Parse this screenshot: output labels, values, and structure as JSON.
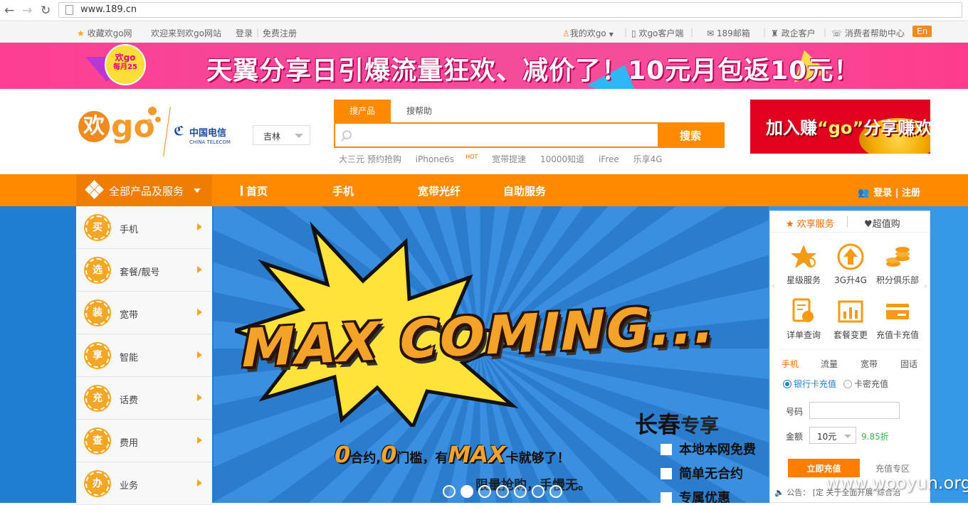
{
  "browser": {
    "url": "www.189.cn"
  },
  "topbar": {
    "favorite": "收藏欢go网",
    "welcome": "欢迎来到欢go网站",
    "login": "登录",
    "sep": "|",
    "register": "免费注册",
    "my_huango": "我的欢go",
    "client": "欢go客户端",
    "mail": "189邮箱",
    "gov": "政企客户",
    "help": "消费者帮助中心",
    "lang": "En"
  },
  "promo": {
    "badge_line1": "欢go",
    "badge_line2": "每月25",
    "title": "天翼分享日引爆流量狂欢、减价了！10元月包返10元！"
  },
  "header": {
    "logo_huan": "欢",
    "logo_go": "go",
    "telecom_cn": "中国电信",
    "telecom_en": "CHINA TELECOM",
    "city": "吉林",
    "ad_text_pre": "加入赚",
    "ad_text_go": "“go”",
    "ad_text_post": "分享赚欢豆"
  },
  "search": {
    "tab_products": "搜产品",
    "tab_help": "搜帮助",
    "placeholder": "",
    "button": "搜索",
    "hotwords": [
      "大三元 预约抢购",
      "iPhone6s",
      "宽带提速",
      "10000知道",
      "iFree",
      "乐享4G"
    ],
    "hot_tag": "HOT"
  },
  "nav": {
    "all_products": "全部产品及服务",
    "links": [
      "首页",
      "手机",
      "宽带光纤",
      "自助服务"
    ],
    "login": "登录",
    "register": "注册"
  },
  "sidemenu": [
    {
      "icon": "买",
      "label": "手机"
    },
    {
      "icon": "选",
      "label": "套餐/靓号"
    },
    {
      "icon": "装",
      "label": "宽带"
    },
    {
      "icon": "享",
      "label": "智能"
    },
    {
      "icon": "充",
      "label": "话费"
    },
    {
      "icon": "查",
      "label": "费用"
    },
    {
      "icon": "办",
      "label": "业务"
    }
  ],
  "banner": {
    "headline": "MAX COMING...",
    "city": "长春",
    "city_suffix": "专享",
    "slogan_zero1": "0",
    "slogan_a": "合约,",
    "slogan_zero2": "0",
    "slogan_b": "门槛，有",
    "slogan_max": "MAX",
    "slogan_c": "卡就够了！",
    "slogan2": "限量抢购，手慢无。",
    "features": [
      "本地本网免费",
      "简单无合约",
      "专属优惠"
    ],
    "slides": 7,
    "active_slide": 2
  },
  "panel": {
    "tab1": "欢享服务",
    "tab2": "超值购",
    "services": [
      "星级服务",
      "3G升4G",
      "积分俱乐部",
      "详单查询",
      "套餐变更",
      "充值卡充值"
    ],
    "recharge_tabs": [
      "手机",
      "流量",
      "宽带",
      "固话"
    ],
    "radio_bank": "银行卡充值",
    "radio_card": "卡密充值",
    "phone_label": "号码",
    "amount_label": "金额",
    "amount_value": "10元",
    "discount": "9.85折",
    "recharge_button": "立即充值",
    "recharge_zone": "充值专区",
    "notice_label": "公告：",
    "notice_text": "[定   关于全面开展“综合治"
  },
  "watermark": "www.wooyun.org",
  "colors": {
    "accent": "#ff8a00",
    "promo_pink": "#f5479a",
    "blue": "#2a86d6"
  }
}
